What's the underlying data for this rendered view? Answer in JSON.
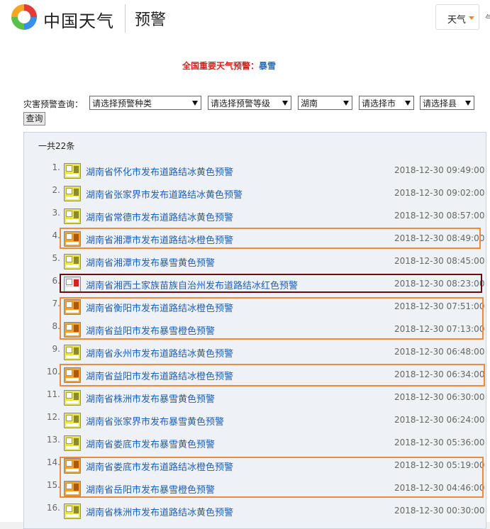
{
  "header": {
    "brand": "中国天气",
    "section_title": "预警",
    "weather_select": "天气",
    "clip_text": "气"
  },
  "ticker": {
    "label": "全国重要天气预警：",
    "value": "暴雪"
  },
  "query": {
    "label": "灾害预警查询：",
    "type_select": "请选择预警种类",
    "level_select": "请选择预警等级",
    "province_select": "湖南",
    "city_select": "请选择市",
    "county_select": "请选择县",
    "button": "查询"
  },
  "list": {
    "count_text": "一共22条",
    "items": [
      {
        "num": "1.",
        "title": "湖南省怀化市发布道路结冰黄色预警",
        "time": "2018-12-30 09:49:00",
        "level": "yellow"
      },
      {
        "num": "2.",
        "title": "湖南省张家界市发布道路结冰黄色预警",
        "time": "2018-12-30 09:02:00",
        "level": "yellow"
      },
      {
        "num": "3.",
        "title": "湖南省常德市发布道路结冰黄色预警",
        "time": "2018-12-30 08:57:00",
        "level": "yellow"
      },
      {
        "num": "4.",
        "title": "湖南省湘潭市发布道路结冰橙色预警",
        "time": "2018-12-30 08:49:00",
        "level": "orange"
      },
      {
        "num": "5.",
        "title": "湖南省湘潭市发布暴雪黄色预警",
        "time": "2018-12-30 08:45:00",
        "level": "yellow"
      },
      {
        "num": "6.",
        "title": "湖南省湘西土家族苗族自治州发布道路结冰红色预警",
        "time": "2018-12-30 08:23:00",
        "level": "red"
      },
      {
        "num": "7.",
        "title": "湖南省衡阳市发布道路结冰橙色预警",
        "time": "2018-12-30 07:51:00",
        "level": "orange"
      },
      {
        "num": "8.",
        "title": "湖南省益阳市发布暴雪橙色预警",
        "time": "2018-12-30 07:13:00",
        "level": "orange"
      },
      {
        "num": "9.",
        "title": "湖南省永州市发布道路结冰黄色预警",
        "time": "2018-12-30 06:48:00",
        "level": "yellow"
      },
      {
        "num": "10.",
        "title": "湖南省益阳市发布道路结冰橙色预警",
        "time": "2018-12-30 06:34:00",
        "level": "orange"
      },
      {
        "num": "11.",
        "title": "湖南省株洲市发布暴雪黄色预警",
        "time": "2018-12-30 06:30:00",
        "level": "yellow"
      },
      {
        "num": "12.",
        "title": "湖南省张家界市发布暴雪黄色预警",
        "time": "2018-12-30 06:24:00",
        "level": "yellow"
      },
      {
        "num": "13.",
        "title": "湖南省娄底市发布暴雪黄色预警",
        "time": "2018-12-30 05:36:00",
        "level": "yellow"
      },
      {
        "num": "14.",
        "title": "湖南省娄底市发布道路结冰橙色预警",
        "time": "2018-12-30 05:19:00",
        "level": "orange"
      },
      {
        "num": "15.",
        "title": "湖南省岳阳市发布暴雪橙色预警",
        "time": "2018-12-30 04:46:00",
        "level": "orange"
      },
      {
        "num": "16.",
        "title": "湖南省株洲市发布道路结冰黄色预警",
        "time": "2018-12-30 00:30:00",
        "level": "yellow"
      }
    ]
  }
}
